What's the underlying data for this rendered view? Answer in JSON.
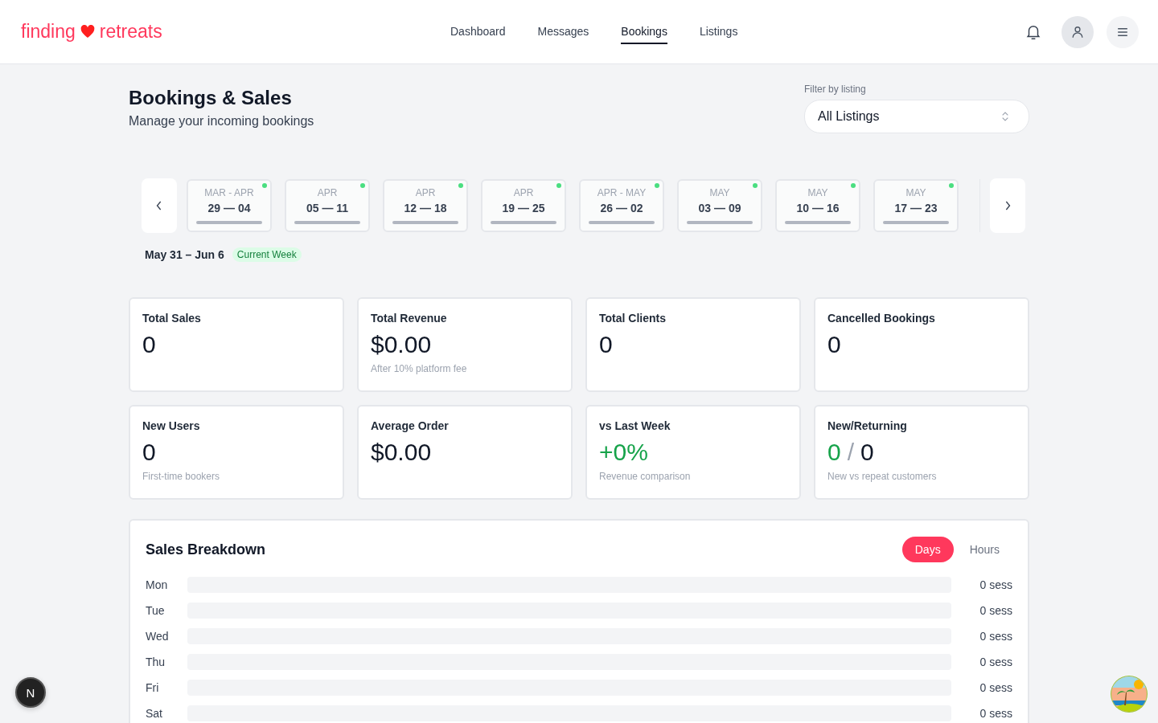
{
  "brand": {
    "left": "finding",
    "right": "retreats"
  },
  "nav": [
    {
      "label": "Dashboard",
      "selected": false
    },
    {
      "label": "Messages",
      "selected": false
    },
    {
      "label": "Bookings",
      "selected": true
    },
    {
      "label": "Listings",
      "selected": false
    }
  ],
  "page": {
    "title": "Bookings & Sales",
    "subtitle": "Manage your incoming bookings"
  },
  "filter": {
    "label": "Filter by listing",
    "value": "All Listings"
  },
  "weeks": [
    {
      "month": "MAR - APR",
      "days": "29 — 04"
    },
    {
      "month": "APR",
      "days": "05 — 11"
    },
    {
      "month": "APR",
      "days": "12 — 18"
    },
    {
      "month": "APR",
      "days": "19 — 25"
    },
    {
      "month": "APR - MAY",
      "days": "26 — 02"
    },
    {
      "month": "MAY",
      "days": "03 — 09"
    },
    {
      "month": "MAY",
      "days": "10 — 16"
    },
    {
      "month": "MAY",
      "days": "17 — 23"
    }
  ],
  "current_week": {
    "range": "May 31 – Jun 6",
    "badge": "Current Week"
  },
  "stats": [
    {
      "label": "Total Sales",
      "value": "0"
    },
    {
      "label": "Total Revenue",
      "value": "$0.00",
      "note": "After 10% platform fee"
    },
    {
      "label": "Total Clients",
      "value": "0"
    },
    {
      "label": "Cancelled Bookings",
      "value": "0"
    },
    {
      "label": "New Users",
      "value": "0",
      "note": "First-time bookers"
    },
    {
      "label": "Average Order",
      "value": "$0.00"
    },
    {
      "label": "vs Last Week",
      "value": "+0%",
      "kind": "positive",
      "note": "Revenue comparison"
    },
    {
      "label": "New/Returning",
      "kind": "split",
      "new": "0",
      "sep": "/",
      "returning": "0",
      "note": "New vs repeat customers"
    }
  ],
  "breakdown": {
    "title": "Sales Breakdown",
    "tabs": [
      {
        "label": "Days",
        "selected": true
      },
      {
        "label": "Hours",
        "selected": false
      }
    ],
    "rows": [
      {
        "day": "Mon",
        "reading": "0 sess"
      },
      {
        "day": "Tue",
        "reading": "0 sess"
      },
      {
        "day": "Wed",
        "reading": "0 sess"
      },
      {
        "day": "Thu",
        "reading": "0 sess"
      },
      {
        "day": "Fri",
        "reading": "0 sess"
      },
      {
        "day": "Sat",
        "reading": "0 sess"
      }
    ]
  },
  "dev_badge": "N"
}
